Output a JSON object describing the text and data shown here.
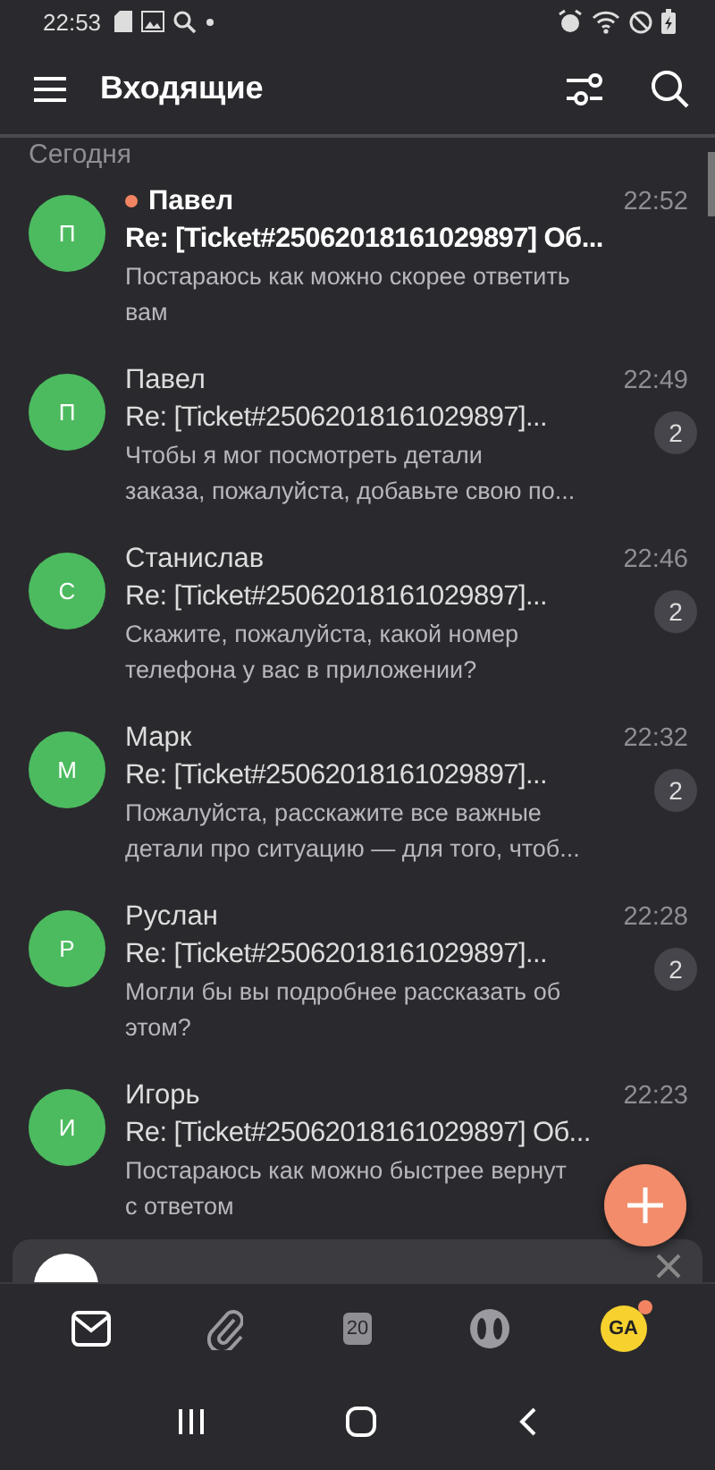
{
  "status_bar": {
    "time": "22:53"
  },
  "app_bar": {
    "title": "Входящие"
  },
  "section": "Сегодня",
  "messages": [
    {
      "initial": "П",
      "sender": "Павел",
      "unread": true,
      "time": "22:52",
      "subject": "Re: [Ticket#25062018161029897] Об...",
      "preview_lines": [
        "Постараюсь как можно скорее ответить",
        "вам"
      ]
    },
    {
      "initial": "П",
      "sender": "Павел",
      "unread": false,
      "time": "22:49",
      "subject": "Re: [Ticket#25062018161029897]...",
      "preview_lines": [
        "Чтобы я мог посмотреть детали",
        "заказа, пожалуйста, добавьте свою по..."
      ],
      "count": "2"
    },
    {
      "initial": "С",
      "sender": "Станислав",
      "unread": false,
      "time": "22:46",
      "subject": "Re: [Ticket#25062018161029897]...",
      "preview_lines": [
        "Скажите, пожалуйста, какой номер",
        "телефона у вас в приложении?"
      ],
      "count": "2"
    },
    {
      "initial": "М",
      "sender": "Марк",
      "unread": false,
      "time": "22:32",
      "subject": "Re: [Ticket#25062018161029897]...",
      "preview_lines": [
        "Пожалуйста, расскажите все важные",
        "детали про ситуацию — для того, чтоб..."
      ],
      "count": "2"
    },
    {
      "initial": "Р",
      "sender": "Руслан",
      "unread": false,
      "time": "22:28",
      "subject": "Re: [Ticket#25062018161029897]...",
      "preview_lines": [
        "Могли бы вы подробнее рассказать об",
        "этом?"
      ],
      "count": "2"
    },
    {
      "initial": "И",
      "sender": "Игорь",
      "unread": false,
      "time": "22:23",
      "subject": "Re: [Ticket#25062018161029897] Об...",
      "preview_lines": [
        "Постараюсь как можно быстрее вернут",
        "с ответом"
      ]
    }
  ],
  "tabs": [
    {
      "kind": "mail",
      "selected": true
    },
    {
      "kind": "attachments",
      "selected": false
    },
    {
      "kind": "calendar",
      "label": "20",
      "selected": false
    },
    {
      "kind": "telemost",
      "selected": false
    },
    {
      "kind": "profile",
      "label": "GA",
      "notification": true,
      "selected": false
    }
  ]
}
